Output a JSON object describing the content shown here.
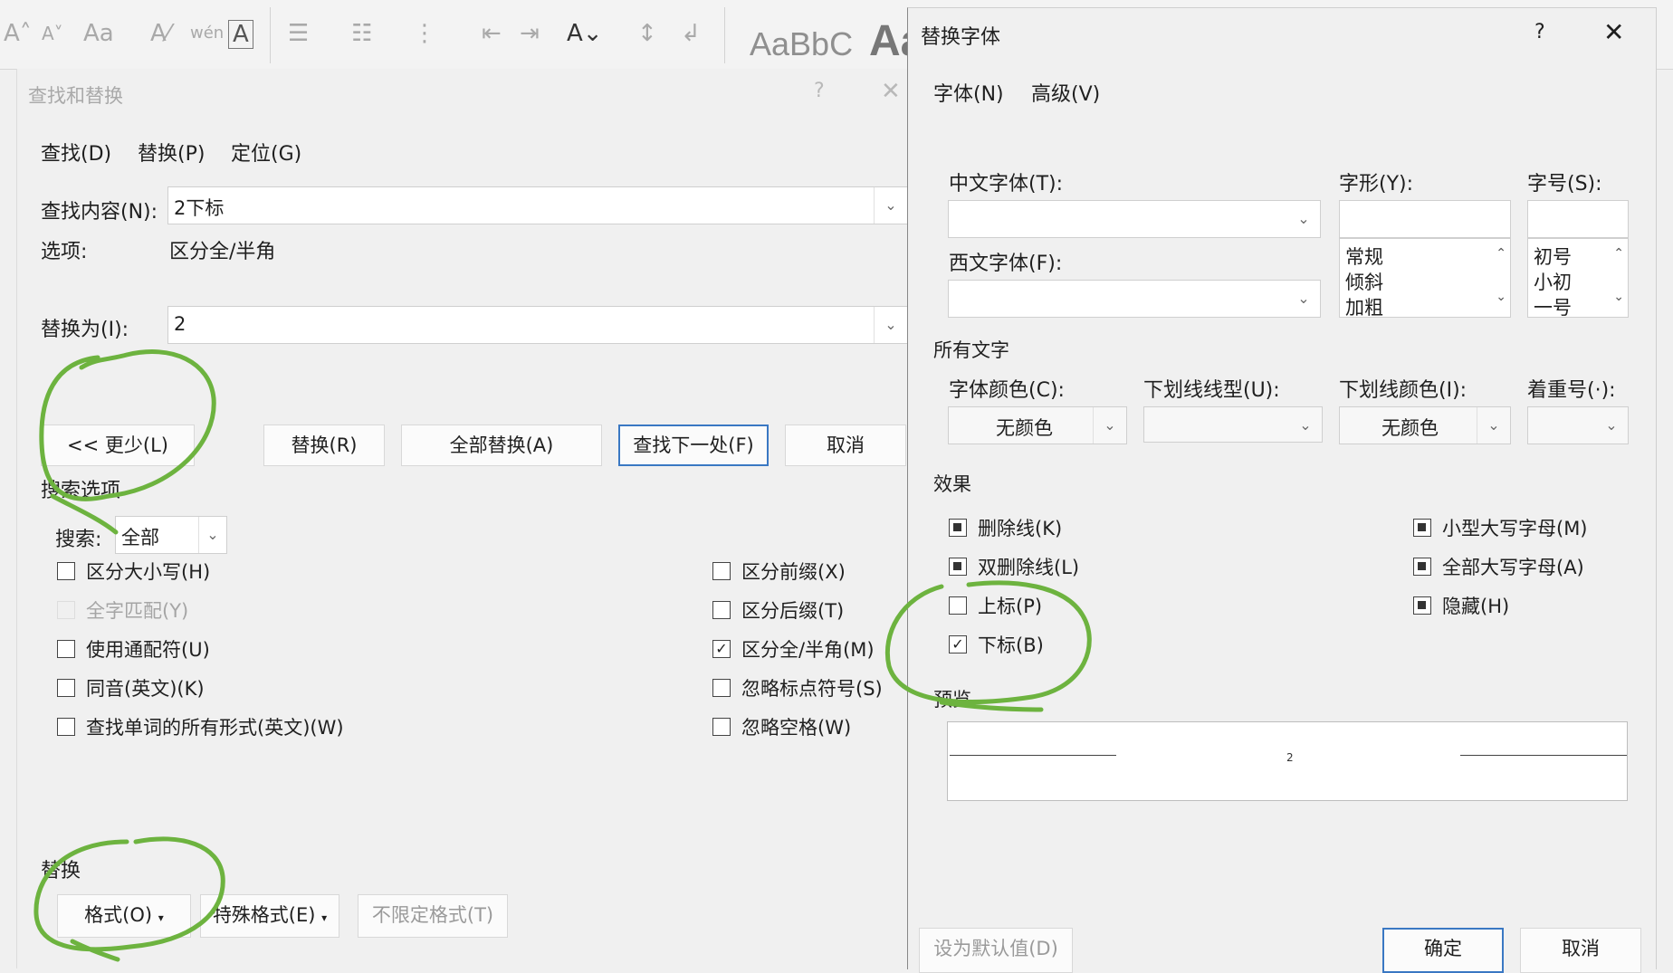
{
  "ribbon": {
    "style_preview": "AaBbC",
    "style_big": "Aa"
  },
  "find_replace": {
    "title": "查找和替换",
    "help": "?",
    "close": "✕",
    "tabs": [
      "查找(D)",
      "替换(P)",
      "定位(G)"
    ],
    "find_label": "查找内容(N):",
    "find_value": "2下标",
    "options_label": "选项:",
    "options_value": "区分全/半角",
    "replace_label": "替换为(I):",
    "replace_value": "2",
    "buttons": {
      "less": "<< 更少(L)",
      "replace": "替换(R)",
      "replace_all": "全部替换(A)",
      "find_next": "查找下一处(F)",
      "cancel": "取消"
    },
    "search_options_title": "搜索选项",
    "search_label": "搜索:",
    "search_value": "全部",
    "left_checks": [
      {
        "label": "区分大小写(H)",
        "checked": false,
        "disabled": false
      },
      {
        "label": "全字匹配(Y)",
        "checked": false,
        "disabled": true
      },
      {
        "label": "使用通配符(U)",
        "checked": false,
        "disabled": false
      },
      {
        "label": "同音(英文)(K)",
        "checked": false,
        "disabled": false
      },
      {
        "label": "查找单词的所有形式(英文)(W)",
        "checked": false,
        "disabled": false
      }
    ],
    "right_checks": [
      {
        "label": "区分前缀(X)",
        "checked": false
      },
      {
        "label": "区分后缀(T)",
        "checked": false
      },
      {
        "label": "区分全/半角(M)",
        "checked": true
      },
      {
        "label": "忽略标点符号(S)",
        "checked": false
      },
      {
        "label": "忽略空格(W)",
        "checked": false
      }
    ],
    "replace_section_title": "替换",
    "format_button": "格式(O)",
    "special_button": "特殊格式(E)",
    "no_format_button": "不限定格式(T)"
  },
  "replace_font": {
    "title": "替换字体",
    "help": "?",
    "close": "✕",
    "tabs": [
      "字体(N)",
      "高级(V)"
    ],
    "cn_font_label": "中文字体(T):",
    "style_label": "字形(Y):",
    "size_label": "字号(S):",
    "west_font_label": "西文字体(F):",
    "style_items": [
      "常规",
      "倾斜",
      "加粗"
    ],
    "size_items": [
      "初号",
      "小初",
      "一号"
    ],
    "all_text_title": "所有文字",
    "font_color_label": "字体颜色(C):",
    "font_color_value": "无颜色",
    "underline_type_label": "下划线线型(U):",
    "underline_color_label": "下划线颜色(I):",
    "underline_color_value": "无颜色",
    "emphasis_label": "着重号(·):",
    "effects_title": "效果",
    "effects_left": [
      {
        "label": "删除线(K)",
        "state": "indeterminate"
      },
      {
        "label": "双删除线(L)",
        "state": "indeterminate"
      },
      {
        "label": "上标(P)",
        "state": "unchecked"
      },
      {
        "label": "下标(B)",
        "state": "checked"
      }
    ],
    "effects_right": [
      {
        "label": "小型大写字母(M)",
        "state": "indeterminate"
      },
      {
        "label": "全部大写字母(A)",
        "state": "indeterminate"
      },
      {
        "label": "隐藏(H)",
        "state": "indeterminate"
      }
    ],
    "preview_title": "预览",
    "preview_text": "2",
    "default_button": "设为默认值(D)",
    "ok_button": "确定",
    "cancel_button": "取消"
  },
  "colors": {
    "annotation_green": "#6db33f",
    "primary_border": "#3a78c3"
  }
}
